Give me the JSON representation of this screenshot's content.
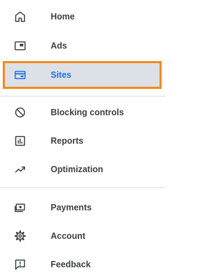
{
  "nav": {
    "items": [
      {
        "label": "Home",
        "icon": "home-icon"
      },
      {
        "label": "Ads",
        "icon": "ads-icon"
      },
      {
        "label": "Sites",
        "icon": "sites-icon",
        "active": true
      },
      {
        "label": "Blocking controls",
        "icon": "block-icon"
      },
      {
        "label": "Reports",
        "icon": "reports-icon"
      },
      {
        "label": "Optimization",
        "icon": "trending-up-icon"
      },
      {
        "label": "Payments",
        "icon": "payments-icon"
      },
      {
        "label": "Account",
        "icon": "gear-icon"
      },
      {
        "label": "Feedback",
        "icon": "feedback-icon"
      }
    ]
  },
  "colors": {
    "active_text": "#1a73e8",
    "active_background": "#dde0e6",
    "highlight_border": "#f28a1c",
    "text": "#3c4043",
    "icon": "#3c4043"
  }
}
